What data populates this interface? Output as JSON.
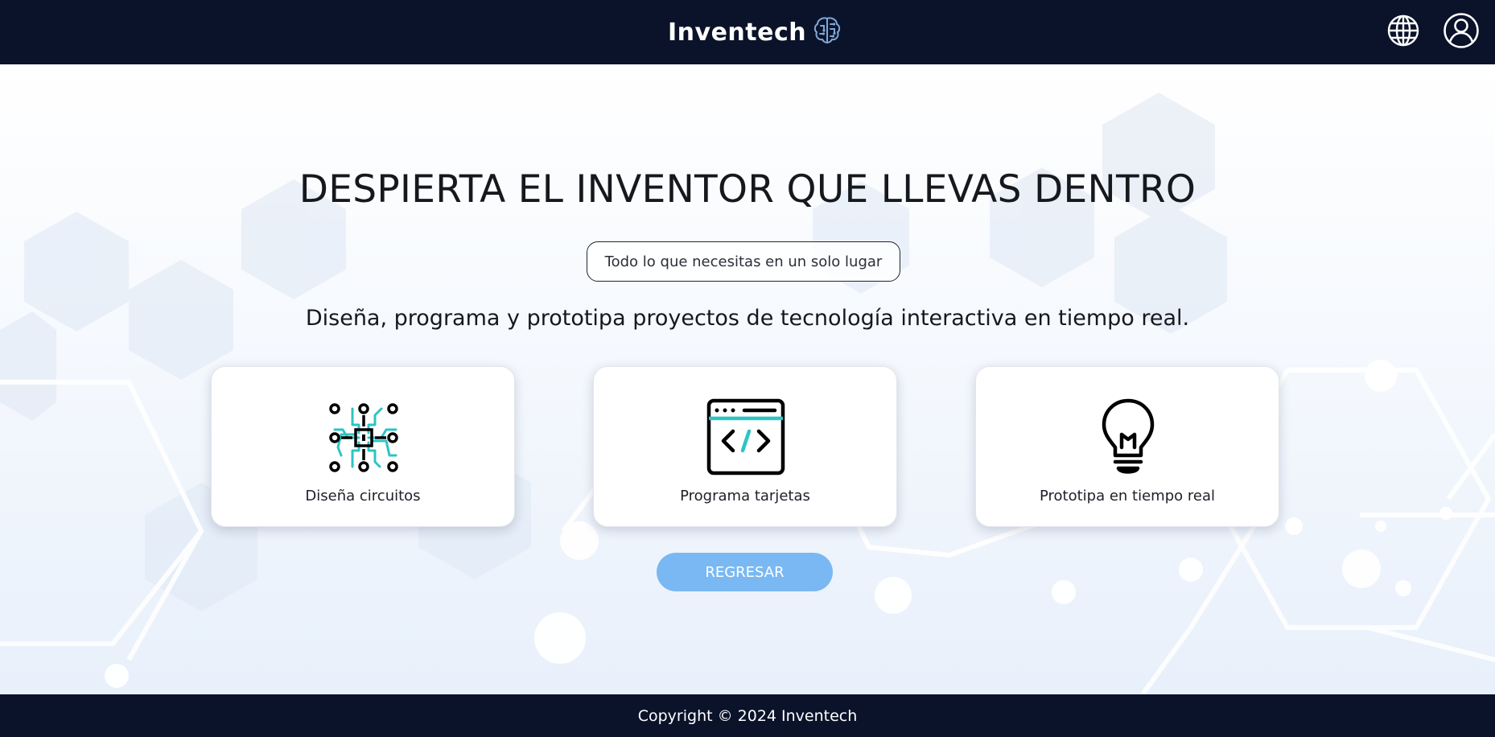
{
  "header": {
    "brand_name": "Inventech",
    "brand_icon": "brain-circuit-icon",
    "language_icon": "globe-icon",
    "account_icon": "user-circle-icon"
  },
  "hero": {
    "headline": "DESPIERTA EL INVENTOR QUE LLEVAS DENTRO",
    "tagline": "Todo lo que necesitas en un solo lugar",
    "description": "Diseña, programa y prototipa proyectos de tecnología interactiva en tiempo real."
  },
  "features": [
    {
      "label": "Diseña circuitos",
      "icon": "circuit-chip-icon"
    },
    {
      "label": "Programa tarjetas",
      "icon": "code-window-icon"
    },
    {
      "label": "Prototipa en tiempo real",
      "icon": "lightbulb-icon"
    }
  ],
  "actions": {
    "back_label": "REGRESAR"
  },
  "footer": {
    "copyright": "Copyright © 2024 Inventech"
  },
  "colors": {
    "header_bg": "#0b132a",
    "accent_teal": "#2ec4c4",
    "button_blue": "#79b8f2",
    "text_dark": "#16181d"
  }
}
